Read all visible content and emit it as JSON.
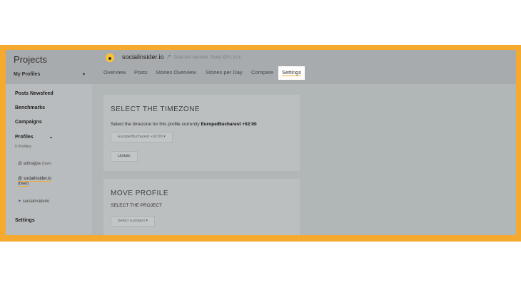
{
  "sidebar": {
    "title": "Projects",
    "profiles_dropdown": "My Profiles",
    "caret": "▾",
    "nav": {
      "posts_newsfeed": "Posts Newsfeed",
      "benchmarks": "Benchmarks",
      "campaigns": "Campaigns",
      "profiles": "Profiles",
      "profiles_caret": "⌄",
      "profiles_count": "5 Profiles",
      "settings": "Settings"
    },
    "profile_items": [
      {
        "icon": "at-icon",
        "handle": "@ adinajipa",
        "owner": "(Own)"
      },
      {
        "icon": "at-icon",
        "handle": "@ socialinsider.io",
        "owner": "(Own)"
      },
      {
        "icon": "twitter-icon",
        "handle": "socialinsiderio",
        "owner": ""
      }
    ]
  },
  "header": {
    "brand": "socialinsider.io",
    "external_link_glyph": "↗",
    "last_updated": "Data last updated: Today @01:12",
    "info_glyph": "ℹ",
    "tabs": [
      "Overview",
      "Posts",
      "Stories Overview",
      "Stories per Day",
      "Compare",
      "Settings"
    ],
    "active_tab": "Settings"
  },
  "timezone_card": {
    "title": "SELECT THE TIMEZONE",
    "description_prefix": "Select the timezone for this profile currently ",
    "current_timezone": "Europe/Bucharest +02:00",
    "select_value": "Europe/Bucharest +02:00 ▾",
    "update_label": "Update"
  },
  "move_card": {
    "title": "MOVE PROFILE",
    "subtitle": "SELECT THE PROJECT",
    "select_value": "Select a project ▾"
  },
  "colors": {
    "frame": "#f5a92f",
    "accent_underline": "#f5a92f",
    "logo": "#ffc332"
  }
}
